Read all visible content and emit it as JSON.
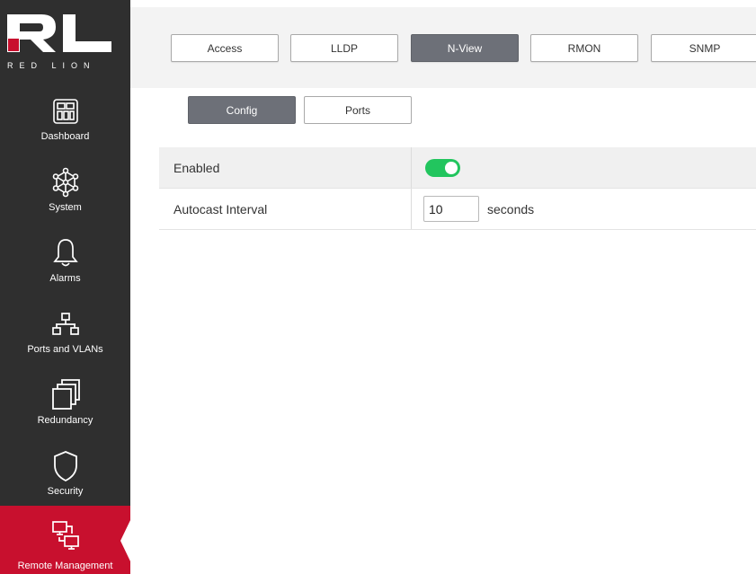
{
  "brand": {
    "name": "RED LION",
    "colors": {
      "sidebar": "#2f2f2f",
      "accent": "#c8102e",
      "toggle_on": "#22c55e",
      "active_tab": "#6d7078"
    }
  },
  "sidebar": {
    "items": [
      {
        "label": "Dashboard",
        "icon": "dashboard-icon"
      },
      {
        "label": "System",
        "icon": "system-network-icon"
      },
      {
        "label": "Alarms",
        "icon": "bell-icon"
      },
      {
        "label": "Ports and VLANs",
        "icon": "network-ports-icon"
      },
      {
        "label": "Redundancy",
        "icon": "stacked-windows-icon"
      },
      {
        "label": "Security",
        "icon": "shield-icon"
      },
      {
        "label": "Remote Management",
        "icon": "remote-screens-icon",
        "active": true
      }
    ]
  },
  "tabs": [
    {
      "label": "Access"
    },
    {
      "label": "LLDP"
    },
    {
      "label": "N-View",
      "active": true
    },
    {
      "label": "RMON"
    },
    {
      "label": "SNMP"
    }
  ],
  "subtabs": [
    {
      "label": "Config",
      "active": true
    },
    {
      "label": "Ports"
    }
  ],
  "settings": {
    "enabled": {
      "label": "Enabled",
      "value": "on"
    },
    "autocast": {
      "label": "Autocast Interval",
      "value": "10",
      "unit": "seconds"
    }
  }
}
